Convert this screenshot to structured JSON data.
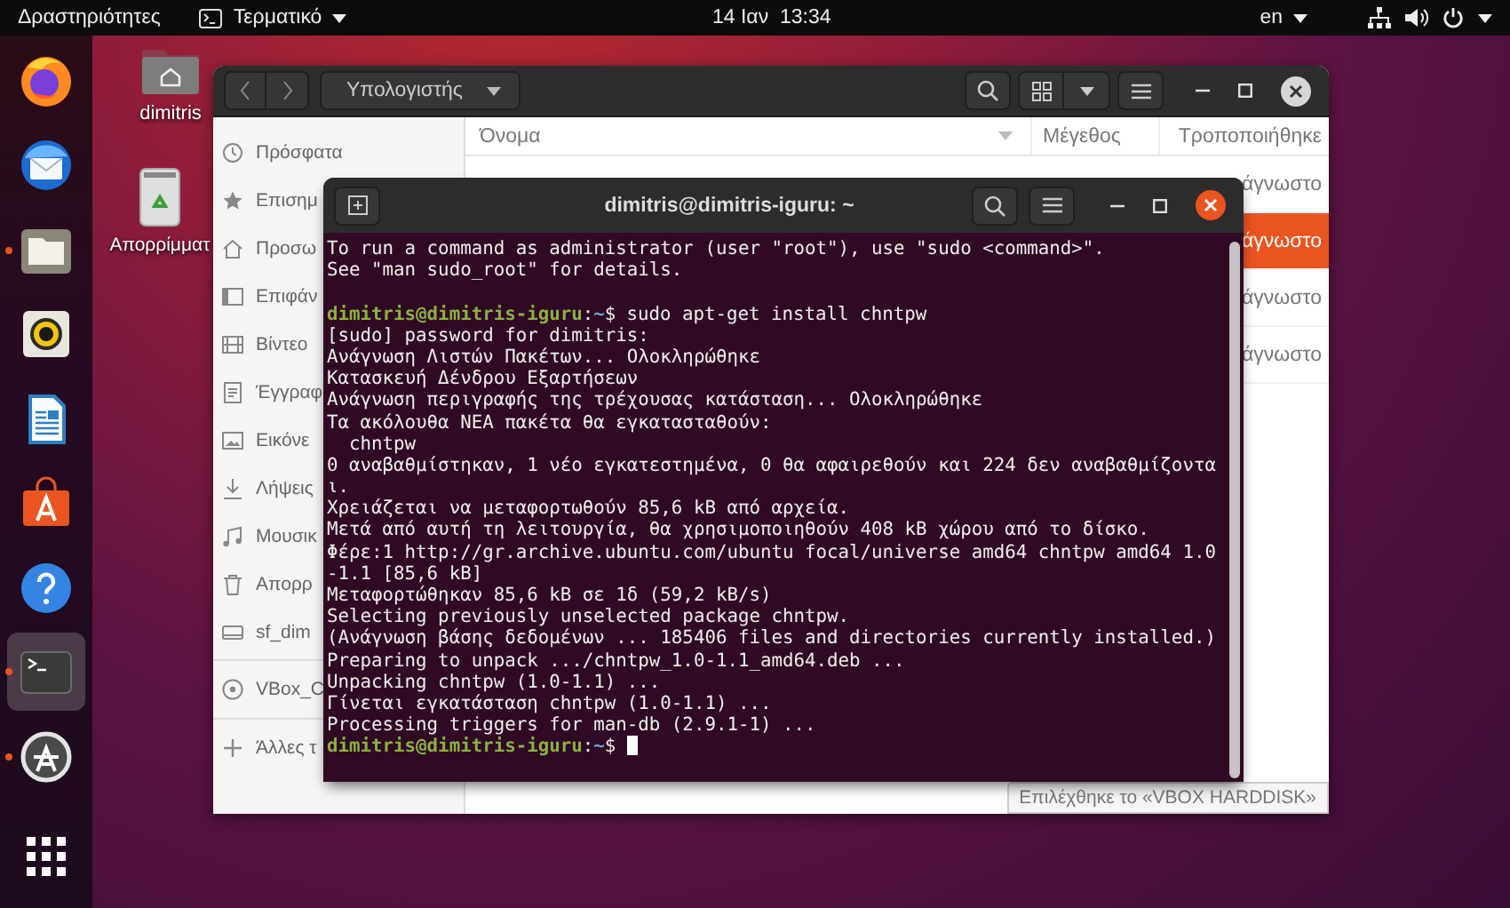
{
  "top_bar": {
    "activities": "Δραστηριότητες",
    "app_menu": "Τερματικό",
    "clock": "14 Ιαν  13:34",
    "keyboard_layout": "en"
  },
  "dock": [
    {
      "kind": "browser",
      "running": false,
      "selected": false
    },
    {
      "kind": "mail",
      "running": false,
      "selected": false
    },
    {
      "kind": "files",
      "running": true,
      "selected": false
    },
    {
      "kind": "music",
      "running": false,
      "selected": false
    },
    {
      "kind": "writer",
      "running": false,
      "selected": false
    },
    {
      "kind": "software",
      "running": false,
      "selected": false
    },
    {
      "kind": "help",
      "running": false,
      "selected": false
    },
    {
      "kind": "terminal",
      "running": true,
      "selected": true
    },
    {
      "kind": "updater",
      "running": true,
      "selected": false
    },
    {
      "kind": "apps",
      "running": false,
      "selected": false
    }
  ],
  "desktop_icons": [
    {
      "kind": "home",
      "label": "dimitris"
    },
    {
      "kind": "trash",
      "label": "Απορρίμματ"
    }
  ],
  "files_window": {
    "location": "Υπολογιστής",
    "sidebar": [
      {
        "kind": "recent",
        "label": "Πρόσφατα"
      },
      {
        "kind": "starred",
        "label": "Επισημ"
      },
      {
        "kind": "home",
        "label": "Προσω"
      },
      {
        "kind": "desktop",
        "label": "Επιφάν"
      },
      {
        "kind": "videos",
        "label": "Βίντεο"
      },
      {
        "kind": "documents",
        "label": "Έγγραφ"
      },
      {
        "kind": "pictures",
        "label": "Εικόνε"
      },
      {
        "kind": "downloads",
        "label": "Λήψεις"
      },
      {
        "kind": "music",
        "label": "Μουσικ"
      },
      {
        "kind": "trash",
        "label": "Απορρ"
      },
      {
        "kind": "drive",
        "label": "sf_dim"
      },
      {
        "kind": "separator"
      },
      {
        "kind": "disc",
        "label": "VBox_C"
      },
      {
        "kind": "separator"
      },
      {
        "kind": "other",
        "label": "Άλλες τ"
      }
    ],
    "columns": [
      "Όνομα",
      "Μέγεθος",
      "Τροποποιήθηκε"
    ],
    "rows": [
      {
        "modified": "άγνωστο",
        "selected": false
      },
      {
        "modified": "άγνωστο",
        "selected": true
      },
      {
        "modified": "άγνωστο",
        "selected": false
      },
      {
        "modified": "άγνωστο",
        "selected": false
      }
    ],
    "status": "Επιλέχθηκε το «VBOX HARDDISK»"
  },
  "terminal": {
    "title": "dimitris@dimitris-iguru: ~",
    "lines": [
      {
        "kind": "output",
        "text": "To run a command as administrator (user \"root\"), use \"sudo <command>\"."
      },
      {
        "kind": "output",
        "text": "See \"man sudo_root\" for details."
      },
      {
        "kind": "blank"
      },
      {
        "kind": "prompt",
        "host": "dimitris@dimitris-iguru",
        "separator": ":",
        "path": "~",
        "symbol": "$",
        "command": "sudo apt-get install chntpw",
        "cursor": false
      },
      {
        "kind": "output",
        "text": "[sudo] password for dimitris:"
      },
      {
        "kind": "output",
        "text": "Ανάγνωση Λιστών Πακέτων... Ολοκληρώθηκε"
      },
      {
        "kind": "output",
        "text": "Κατασκευή Δένδρου Εξαρτήσεων"
      },
      {
        "kind": "output",
        "text": "Ανάγνωση περιγραφής της τρέχουσας κατάσταση... Ολοκληρώθηκε"
      },
      {
        "kind": "output",
        "text": "Τα ακόλουθα ΝΕΑ πακέτα θα εγκατασταθούν:"
      },
      {
        "kind": "output",
        "text": "  chntpw"
      },
      {
        "kind": "output",
        "text": "0 αναβαθμίστηκαν, 1 νέο εγκατεστημένα, 0 θα αφαιρεθούν και 224 δεν αναβαθμίζοντα"
      },
      {
        "kind": "output",
        "text": "ι."
      },
      {
        "kind": "output",
        "text": "Χρειάζεται να μεταφορτωθούν 85,6 kB από αρχεία."
      },
      {
        "kind": "output",
        "text": "Μετά από αυτή τη λειτουργία, θα χρησιμοποιηθούν 408 kB χώρου από το δίσκο."
      },
      {
        "kind": "output",
        "text": "Φέρε:1 http://gr.archive.ubuntu.com/ubuntu focal/universe amd64 chntpw amd64 1.0"
      },
      {
        "kind": "output",
        "text": "-1.1 [85,6 kB]"
      },
      {
        "kind": "output",
        "text": "Μεταφορτώθηκαν 85,6 kB σε 1δ (59,2 kB/s)"
      },
      {
        "kind": "output",
        "text": "Selecting previously unselected package chntpw."
      },
      {
        "kind": "output",
        "text": "(Ανάγνωση βάσης δεδομένων ... 185406 files and directories currently installed.)"
      },
      {
        "kind": "output",
        "text": "Preparing to unpack .../chntpw_1.0-1.1_amd64.deb ..."
      },
      {
        "kind": "output",
        "text": "Unpacking chntpw (1.0-1.1) ..."
      },
      {
        "kind": "output",
        "text": "Γίνεται εγκατάσταση chntpw (1.0-1.1) ..."
      },
      {
        "kind": "output",
        "text": "Processing triggers for man-db (2.9.1-1) ..."
      },
      {
        "kind": "prompt",
        "host": "dimitris@dimitris-iguru",
        "separator": ":",
        "path": "~",
        "symbol": "$",
        "cursor": true
      }
    ]
  }
}
